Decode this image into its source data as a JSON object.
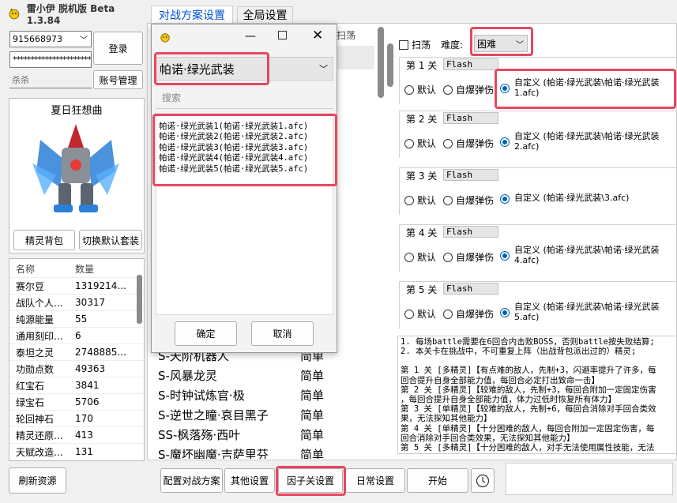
{
  "window": {
    "title": "雷小伊 脱机版 Beta 1.3.84"
  },
  "tabs": [
    {
      "label": "对战方案设置"
    },
    {
      "label": "全局设置"
    }
  ],
  "login": {
    "account": "915668973",
    "password": "**************************",
    "server": "杀杀",
    "login_label": "登录",
    "manage_label": "账号管理"
  },
  "pet": {
    "name": "夏日狂想曲",
    "bag_label": "精灵背包",
    "switch_label": "切换默认套装"
  },
  "resources": {
    "headers": [
      "名称",
      "数量"
    ],
    "rows": [
      [
        "赛尔豆",
        "1319214..."
      ],
      [
        "战队个人...",
        "30317"
      ],
      [
        "纯源能量",
        "55"
      ],
      [
        "通用刻印...",
        "6"
      ],
      [
        "泰坦之灵",
        "2748885..."
      ],
      [
        "功勋点数",
        "49363"
      ],
      [
        "红宝石",
        "3841"
      ],
      [
        "绿宝石",
        "5706"
      ],
      [
        "轮回神石",
        "170"
      ],
      [
        "精灵还原...",
        "413"
      ],
      [
        "天赋改造...",
        "131"
      ]
    ]
  },
  "refresh_label": "刷新资源",
  "popup": {
    "selected": "帕诺·绿光武装",
    "search_placeholder": "搜索",
    "items": [
      "帕诺·绿光武装1(帕诺·绿光武装1.afc)",
      "帕诺·绿光武装2(帕诺·绿光武装2.afc)",
      "帕诺·绿光武装3(帕诺·绿光武装3.afc)",
      "帕诺·绿光武装4(帕诺·绿光武装4.afc)",
      "帕诺·绿光武装5(帕诺·绿光武装5.afc)"
    ],
    "ok_label": "确定",
    "cancel_label": "取消"
  },
  "boss_list": {
    "header_sweep": "扫荡",
    "rows": [
      [
        "S-天阶机器人",
        "简单"
      ],
      [
        "S-风暴龙灵",
        "简单"
      ],
      [
        "S-时钟试炼官·极",
        "简单"
      ],
      [
        "S-逆世之瞳·哀目黑子",
        "简单"
      ],
      [
        "SS-枫落殇·西叶",
        "简单"
      ],
      [
        "S-魔坏幽魔·吉萨里芬",
        "简单"
      ]
    ]
  },
  "settings": {
    "sweep_label": "扫荡",
    "difficulty_label": "难度:",
    "difficulty_value": "困难",
    "option_default": "默认",
    "option_self_destruct": "自爆弹伤",
    "stages": [
      {
        "label": "第 1 关",
        "mode": "Flash",
        "custom": "自定义 (帕诺·绿光武装\\帕诺·绿光武装",
        "file": "1.afc)"
      },
      {
        "label": "第 2 关",
        "mode": "Flash",
        "custom": "自定义 (帕诺·绿光武装\\帕诺·绿光武装",
        "file": "2.afc)"
      },
      {
        "label": "第 3 关",
        "mode": "Flash",
        "custom": "自定义 (帕诺·绿光武装\\3.afc)",
        "file": ""
      },
      {
        "label": "第 4 关",
        "mode": "Flash",
        "custom": "自定义 (帕诺·绿光武装\\帕诺·绿光武装",
        "file": "4.afc)"
      },
      {
        "label": "第 5 关",
        "mode": "Flash",
        "custom": "自定义 (帕诺·绿光武装\\帕诺·绿光武装",
        "file": "5.afc)"
      }
    ]
  },
  "description": [
    "1. 每场battle需要在6回合内击败BOSS，否则battle按失败结算;",
    "2. 本关卡在挑战中，不可重复上阵（出战背包派出过的）精灵;",
    "",
    "第 1 关 [多精灵]【有点难的敌人，先制+3，闪避率提升了许多，每",
    "回合提升自身全部能力值，每回合必定打出致命一击】",
    "第 2 关 [多精灵]【较难的敌人，先制+3，每回合附加一定固定伤害",
    "，每回合提升自身全部能力值，体力过低时恢复所有体力】",
    "第 3 关 [单精灵]【较难的敌人，先制+6，每回合消除对手回合类效",
    "果，无法探知其他能力】",
    "第 4 关 [单精灵]【十分困难的敌人，每回合附加一定固定伤害，每",
    "回合消除对手回合类效果，无法探知其他能力】",
    "第 5 关 [多精灵]【十分困难的敌人，对手无法使用属性技能，无法"
  ],
  "bottom": {
    "configure_label": "配置对战方案",
    "other_label": "其他设置",
    "factor_label": "因子关设置",
    "daily_label": "日常设置",
    "start_label": "开始"
  }
}
